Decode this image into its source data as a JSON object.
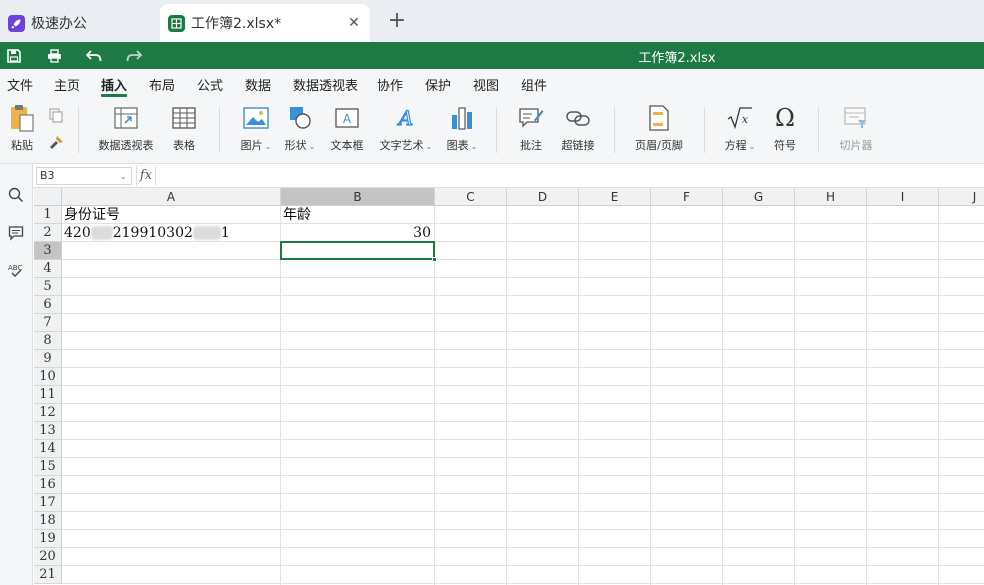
{
  "tabs": [
    {
      "label": "极速办公",
      "icon": "rocket-icon"
    },
    {
      "label": "工作簿2.xlsx*",
      "icon": "spreadsheet-icon"
    }
  ],
  "document_title": "工作簿2.xlsx",
  "menu": [
    "文件",
    "主页",
    "插入",
    "布局",
    "公式",
    "数据",
    "数据透视表",
    "协作",
    "保护",
    "视图",
    "组件"
  ],
  "active_menu": "插入",
  "ribbon": {
    "paste": "粘贴",
    "pivot_table": "数据透视表",
    "table": "表格",
    "image": "图片",
    "shape": "形状",
    "text_box": "文本框",
    "text_art": "文字艺术",
    "chart": "图表",
    "comment": "批注",
    "hyperlink": "超链接",
    "header_footer": "页眉/页脚",
    "equation": "方程",
    "symbol": "符号",
    "slicer": "切片器"
  },
  "formula_bar": {
    "name_box": "B3",
    "fx": "fx",
    "formula": ""
  },
  "sheet": {
    "columns": [
      "A",
      "B",
      "C",
      "D",
      "E",
      "F",
      "G",
      "H",
      "I",
      "J"
    ],
    "selected_column": "B",
    "rows": [
      "1",
      "2",
      "3",
      "4",
      "5",
      "6",
      "7",
      "8",
      "9",
      "10",
      "11",
      "12",
      "13",
      "14",
      "15",
      "16",
      "17",
      "18",
      "19",
      "20",
      "21"
    ],
    "selected_row": "3",
    "cells": {
      "A1": "身份证号",
      "B1": "年龄",
      "A2_part1": "420",
      "A2_part2": "219910302",
      "A2_part3": "1",
      "B2": "30"
    }
  },
  "colors": {
    "brand_green": "#1e7a45",
    "tab_bar": "#eaedf1"
  }
}
